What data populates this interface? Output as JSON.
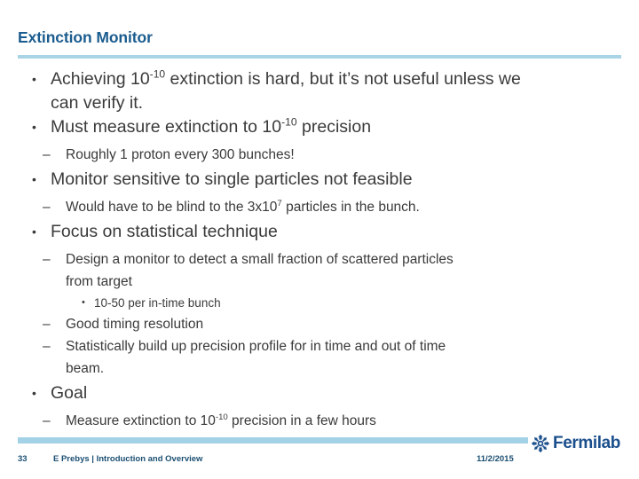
{
  "slide": {
    "title": "Extinction Monitor",
    "accent_rule_color": "#a9d4e6",
    "title_color": "#1b5c8e",
    "body_text_color": "#3a3a3a",
    "bullet_glyph_l1": "•",
    "bullet_glyph_l2": "–",
    "bullet_glyph_l3": "•"
  },
  "content": {
    "b1_a": "Achieving 10",
    "b1_a_sup": "-10",
    "b1_a_rest": " extinction is hard, but it’s not useful unless we",
    "b1_b": "can verify it.",
    "b2_a": "Must measure extinction to 10",
    "b2_a_sup": "-10",
    "b2_a_rest": " precision",
    "b2_sub1": "Roughly 1 proton every 300 bunches!",
    "b3": "Monitor sensitive to single particles not feasible",
    "b3_sub1_a": "Would have to be blind to the 3x10",
    "b3_sub1_sup": "7",
    "b3_sub1_rest": " particles in the bunch.",
    "b4": "Focus on statistical technique",
    "b4_sub1_a": "Design a monitor to detect a small fraction of scattered particles",
    "b4_sub1_b": "from target",
    "b4_sub1_sub1": "10-50 per in-time bunch",
    "b4_sub2": "Good timing resolution",
    "b4_sub3_a": "Statistically build up precision profile for in time and out of time",
    "b4_sub3_b": "beam.",
    "b5": "Goal",
    "b5_sub1_a": "Measure extinction to 10",
    "b5_sub1_sup": "-10",
    "b5_sub1_rest": " precision in a few hours"
  },
  "footer": {
    "page_number": "33",
    "attribution": "E  Prebys | Introduction and Overview",
    "date": "11/2/2015",
    "logo_word": "Fermilab",
    "logo_color": "#1b4f8c",
    "rule_color": "#a3d2e6",
    "text_color": "#1b4f72"
  }
}
